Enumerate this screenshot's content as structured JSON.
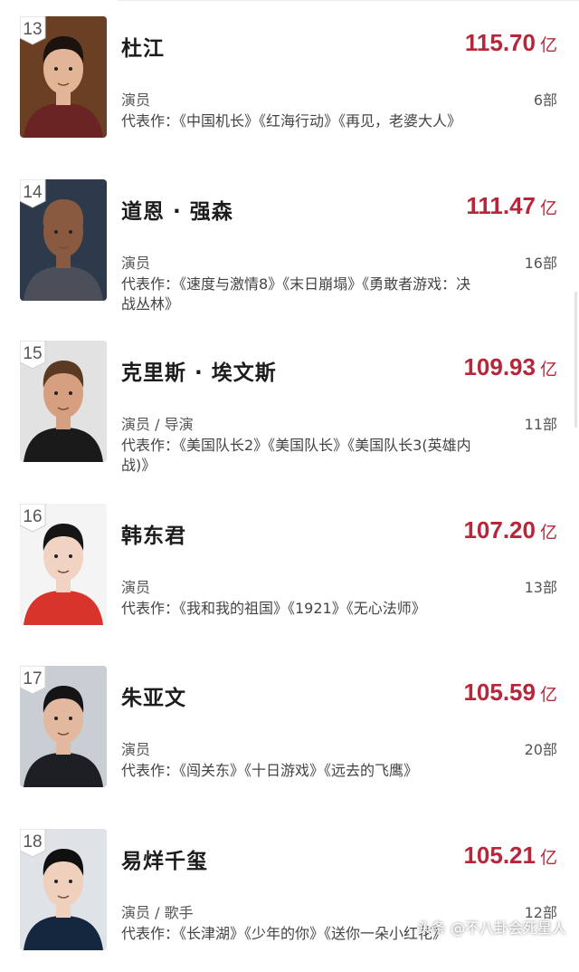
{
  "items": [
    {
      "rank": "13",
      "name": "杜江",
      "value": "115.70",
      "unit": "亿",
      "role": "演员",
      "count": "6部",
      "works": "代表作：《中国机长》《红海行动》《再见，老婆大人》",
      "photo": {
        "bg": "#6b3f23",
        "skin": "#e3b597",
        "hair": "#1c130e",
        "shirt": "#6a2424"
      }
    },
    {
      "rank": "14",
      "name": "道恩 · 强森",
      "value": "111.47",
      "unit": "亿",
      "role": "演员",
      "count": "16部",
      "works": "代表作：《速度与激情8》《末日崩塌》《勇敢者游戏：决战丛林》",
      "photo": {
        "bg": "#2c3a4b",
        "skin": "#8a5a40",
        "hair": "#8a5a40",
        "shirt": "#4a4f5a"
      }
    },
    {
      "rank": "15",
      "name": "克里斯 · 埃文斯",
      "value": "109.93",
      "unit": "亿",
      "role": "演员 / 导演",
      "count": "11部",
      "works": "代表作：《美国队长2》《美国队长》《美国队长3(英雄内战)》",
      "photo": {
        "bg": "#e2e2e2",
        "skin": "#d6a080",
        "hair": "#5a3a22",
        "shirt": "#1a1a1a"
      }
    },
    {
      "rank": "16",
      "name": "韩东君",
      "value": "107.20",
      "unit": "亿",
      "role": "演员",
      "count": "13部",
      "works": "代表作：《我和我的祖国》《1921》《无心法师》",
      "photo": {
        "bg": "#f4f4f4",
        "skin": "#f1d3c3",
        "hair": "#151515",
        "shirt": "#d9342b"
      }
    },
    {
      "rank": "17",
      "name": "朱亚文",
      "value": "105.59",
      "unit": "亿",
      "role": "演员",
      "count": "20部",
      "works": "代表作：《闯关东》《十日游戏》《远去的飞鹰》",
      "photo": {
        "bg": "#c9ced4",
        "skin": "#e2b89f",
        "hair": "#141414",
        "shirt": "#1d1f24"
      }
    },
    {
      "rank": "18",
      "name": "易烊千玺",
      "value": "105.21",
      "unit": "亿",
      "role": "演员 / 歌手",
      "count": "12部",
      "works": "代表作：《长津湖》《少年的你》《送你一朵小红花》",
      "photo": {
        "bg": "#dfe3e8",
        "skin": "#efd0bd",
        "hair": "#101010",
        "shirt": "#15263f"
      }
    }
  ],
  "watermark": "头条 @不八卦会死星人"
}
